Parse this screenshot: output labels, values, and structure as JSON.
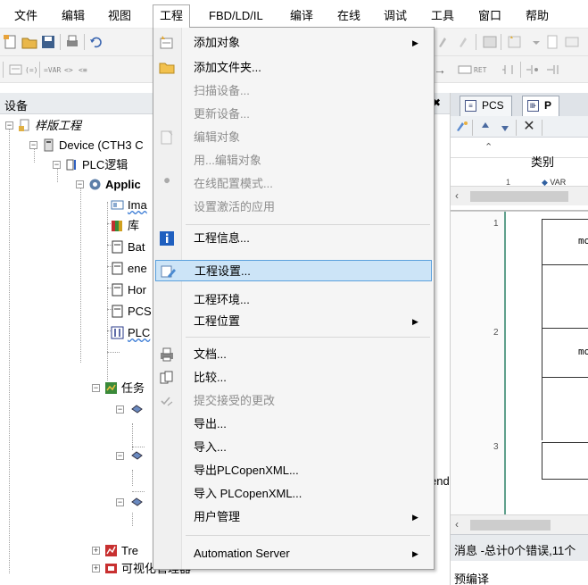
{
  "menubar": {
    "items": [
      {
        "label": "文件"
      },
      {
        "label": "编辑"
      },
      {
        "label": "视图"
      },
      {
        "label": "工程"
      },
      {
        "label": "FBD/LD/IL"
      },
      {
        "label": "编译"
      },
      {
        "label": "在线"
      },
      {
        "label": "调试"
      },
      {
        "label": "工具"
      },
      {
        "label": "窗口"
      },
      {
        "label": "帮助"
      }
    ],
    "open_item": "工程"
  },
  "toolbar2": {
    "var_text": "=VAR",
    "ret_text": "RET"
  },
  "devices": {
    "title": "设备",
    "tree": {
      "project": "样版工程",
      "device": "Device (CTH3 C",
      "plc_logic": "PLC逻辑",
      "application": "Applic",
      "items": [
        "Ima",
        "库",
        "Bat",
        "ene",
        "Hor",
        "PCS",
        "PLC",
        "任务"
      ],
      "trend": "Tre",
      "visualization_manager": "可视化管理器",
      "partial_end": "end"
    }
  },
  "editor": {
    "tabs": [
      {
        "label": "PCS",
        "icon": "document-icon"
      },
      {
        "label": "P",
        "icon": "fbd-icon"
      }
    ],
    "variables": {
      "column_header": "类别",
      "row1_num": "1",
      "row1_kind": "VAR"
    },
    "fbd": {
      "networks": [
        {
          "number": "1",
          "text": "mo"
        },
        {
          "number": "2",
          "text": "mo"
        },
        {
          "number": "3",
          "text": ""
        }
      ]
    },
    "messages": "消息 -总计0个错误,11个",
    "precompile": "预编译"
  },
  "dropdown": {
    "items": [
      {
        "label": "添加对象",
        "icon": "add-object-icon",
        "enabled": true,
        "submenu": true
      },
      {
        "label": "添加文件夹...",
        "icon": "folder-icon",
        "enabled": true
      },
      {
        "label": "扫描设备...",
        "enabled": false
      },
      {
        "label": "更新设备...",
        "enabled": false
      },
      {
        "label": "编辑对象",
        "icon": "edit-object-icon",
        "enabled": false
      },
      {
        "label": "用...编辑对象",
        "enabled": false
      },
      {
        "label": "在线配置模式...",
        "icon": "wrench-icon",
        "enabled": false
      },
      {
        "label": "设置激活的应用",
        "enabled": false
      },
      {
        "label": "工程信息...",
        "icon": "info-icon",
        "enabled": true
      },
      {
        "label": "工程设置...",
        "icon": "settings-pencil-icon",
        "enabled": true,
        "highlighted": true
      },
      {
        "label": "工程环境...",
        "enabled": true
      },
      {
        "label": "工程位置",
        "enabled": true,
        "submenu": true
      },
      {
        "label": "文档...",
        "icon": "printer-icon",
        "enabled": true
      },
      {
        "label": "比较...",
        "icon": "compare-icon",
        "enabled": true
      },
      {
        "label": "提交接受的更改",
        "icon": "commit-icon",
        "enabled": false
      },
      {
        "label": "导出...",
        "enabled": true
      },
      {
        "label": "导入...",
        "enabled": true
      },
      {
        "label": "导出PLCopenXML...",
        "enabled": true
      },
      {
        "label": "导入 PLCopenXML...",
        "enabled": true
      },
      {
        "label": "用户管理",
        "enabled": true,
        "submenu": true
      },
      {
        "label": "Automation Server",
        "enabled": true,
        "submenu": true
      }
    ]
  }
}
